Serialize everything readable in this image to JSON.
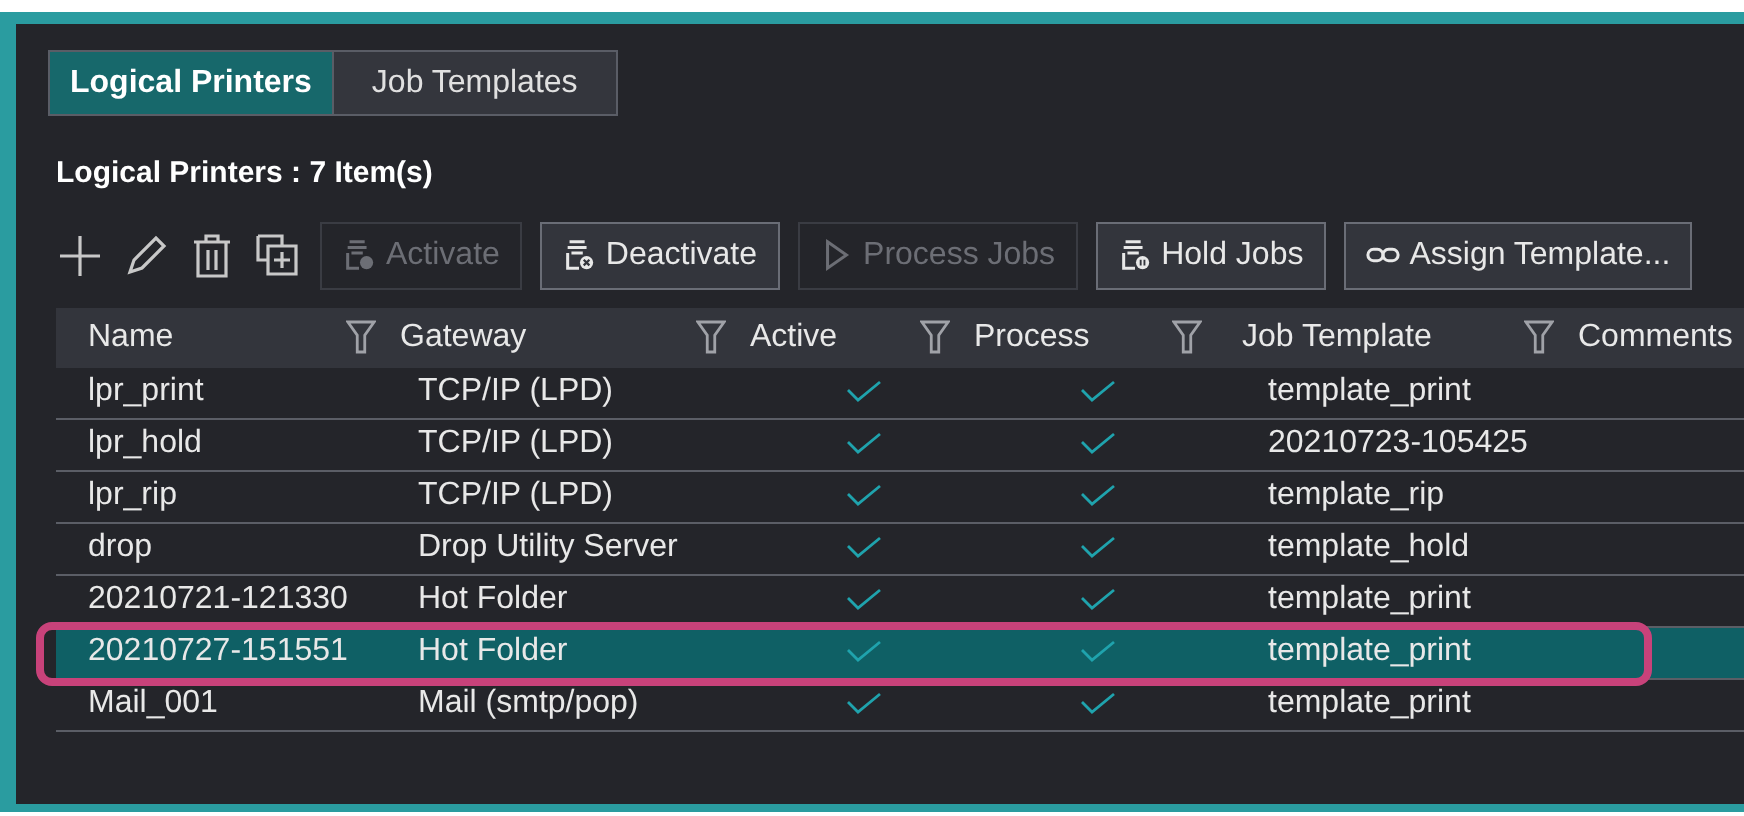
{
  "tabs": [
    {
      "label": "Logical Printers",
      "selected": true
    },
    {
      "label": "Job Templates",
      "selected": false
    }
  ],
  "heading": "Logical Printers : 7 Item(s)",
  "toolbar": {
    "icons": [
      {
        "kind": "add"
      },
      {
        "kind": "edit"
      },
      {
        "kind": "delete"
      },
      {
        "kind": "copy"
      }
    ],
    "buttons": [
      {
        "label": "Activate",
        "disabled": true
      },
      {
        "label": "Deactivate",
        "disabled": false
      },
      {
        "label": "Process Jobs",
        "disabled": true
      },
      {
        "label": "Hold Jobs",
        "disabled": false
      },
      {
        "label": "Assign Template...",
        "disabled": false
      }
    ]
  },
  "table": {
    "columns": [
      {
        "label": "Name",
        "filter": true
      },
      {
        "label": "Gateway",
        "filter": true
      },
      {
        "label": "Active",
        "filter": true
      },
      {
        "label": "Process",
        "filter": true
      },
      {
        "label": "Job Template",
        "filter": true
      },
      {
        "label": "Comments",
        "filter": false
      }
    ],
    "rows": [
      {
        "name": "lpr_print",
        "gateway": "TCP/IP (LPD)",
        "active": true,
        "process": true,
        "job_template": "template_print",
        "selected": false,
        "highlighted": false
      },
      {
        "name": "lpr_hold",
        "gateway": "TCP/IP (LPD)",
        "active": true,
        "process": true,
        "job_template": "20210723-105425",
        "selected": false,
        "highlighted": false
      },
      {
        "name": "lpr_rip",
        "gateway": "TCP/IP (LPD)",
        "active": true,
        "process": true,
        "job_template": "template_rip",
        "selected": false,
        "highlighted": false
      },
      {
        "name": "drop",
        "gateway": "Drop Utility Server",
        "active": true,
        "process": true,
        "job_template": "template_hold",
        "selected": false,
        "highlighted": false
      },
      {
        "name": "20210721-121330",
        "gateway": "Hot Folder",
        "active": true,
        "process": true,
        "job_template": "template_print",
        "selected": false,
        "highlighted": false
      },
      {
        "name": "20210727-151551",
        "gateway": "Hot Folder",
        "active": true,
        "process": true,
        "job_template": "template_print",
        "selected": true,
        "highlighted": true
      },
      {
        "name": "Mail_001",
        "gateway": "Mail (smtp/pop)",
        "active": true,
        "process": true,
        "job_template": "template_print",
        "selected": false,
        "highlighted": false
      }
    ]
  }
}
